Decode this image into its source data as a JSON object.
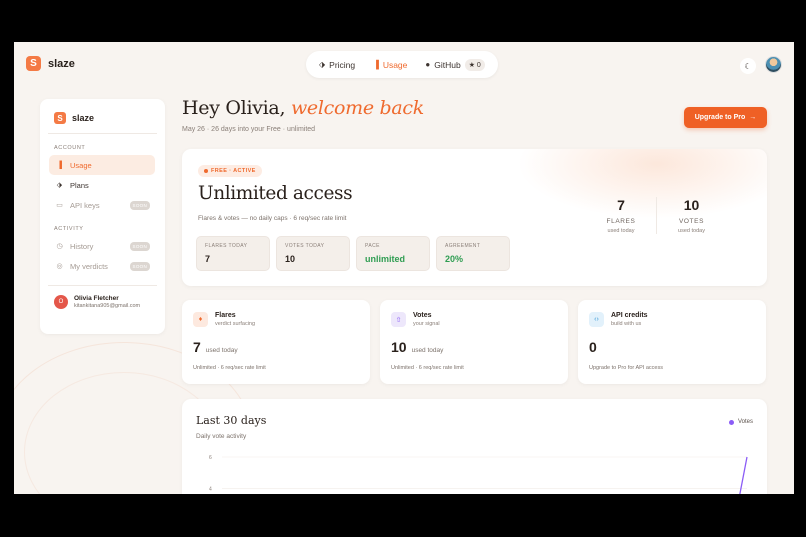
{
  "app": {
    "brand": "slaze",
    "logo_letter": "S"
  },
  "topnav": {
    "items": [
      {
        "label": "Pricing",
        "icon": "tag-icon"
      },
      {
        "label": "Usage",
        "icon": "bar-chart-icon"
      },
      {
        "label": "GitHub",
        "icon": "github-icon"
      }
    ],
    "github_stars": "★ 0"
  },
  "sidebar": {
    "brand": "slaze",
    "account_label": "ACCOUNT",
    "account_items": [
      {
        "label": "Usage",
        "icon": "bar-chart-icon"
      },
      {
        "label": "Plans",
        "icon": "tag-icon"
      },
      {
        "label": "API keys",
        "icon": "key-icon",
        "badge": "SOON"
      }
    ],
    "activity_label": "ACTIVITY",
    "activity_items": [
      {
        "label": "History",
        "icon": "clock-icon",
        "badge": "SOON"
      },
      {
        "label": "My verdicts",
        "icon": "pin-icon",
        "badge": "SOON"
      }
    ],
    "user": {
      "name": "Olivia Fletcher",
      "email": "kitankitana905@gmail.com",
      "initial": "O"
    }
  },
  "header": {
    "greeting_plain": "Hey Olivia,",
    "greeting_accent": "welcome back",
    "subtitle": "May 26 · 26 days into your Free · unlimited",
    "upgrade_label": "Upgrade to Pro",
    "upgrade_arrow": "→"
  },
  "hero": {
    "status": "FREE · ACTIVE",
    "title": "Unlimited access",
    "description": "Flares & votes — no daily caps · 6 req/sec rate limit",
    "stats": [
      {
        "label": "FLARES TODAY",
        "value": "7"
      },
      {
        "label": "VOTES TODAY",
        "value": "10"
      },
      {
        "label": "PACE",
        "value": "unlimited"
      },
      {
        "label": "AGREEMENT",
        "value": "20%"
      }
    ],
    "big": [
      {
        "value": "7",
        "label": "FLARES",
        "sub": "used today"
      },
      {
        "value": "10",
        "label": "VOTES",
        "sub": "used today"
      }
    ]
  },
  "metrics": [
    {
      "title": "Flares",
      "subtitle": "verdict surfacing",
      "value": "7",
      "unit": "used today",
      "footer": "Unlimited · 6 req/sec rate limit",
      "icon": "flame-icon",
      "color": "#fde9df"
    },
    {
      "title": "Votes",
      "subtitle": "your signal",
      "value": "10",
      "unit": "used today",
      "footer": "Unlimited · 6 req/sec rate limit",
      "icon": "upvote-icon",
      "color": "#ede7fb"
    },
    {
      "title": "API credits",
      "subtitle": "build with us",
      "value": "0",
      "unit": "",
      "footer": "Upgrade to Pro for API access",
      "icon": "code-icon",
      "color": "#e2f1fb"
    }
  ],
  "chart_data": {
    "type": "line",
    "title": "Last 30 days",
    "subtitle": "Daily vote activity",
    "series": [
      {
        "name": "Votes",
        "color": "#8b5cf6",
        "values": [
          0,
          0,
          0,
          0,
          0,
          0,
          0,
          0,
          0,
          0,
          0,
          0,
          0,
          0,
          0,
          0,
          0,
          0,
          0,
          0,
          0,
          0,
          0,
          0,
          0,
          0,
          0,
          0,
          0,
          6
        ]
      }
    ],
    "y_ticks": [
      "6",
      "4"
    ],
    "legend_position": "top-right"
  }
}
